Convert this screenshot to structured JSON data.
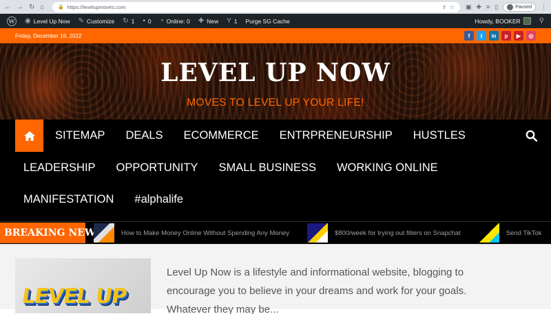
{
  "browser": {
    "url": "https://levelupmoves.com",
    "profile_status": "Paused"
  },
  "adminbar": {
    "site_name": "Level Up Now",
    "customize": "Customize",
    "updates_count": "1",
    "comments_count": "0",
    "online": "Online: 0",
    "new": "New",
    "yoast_count": "1",
    "purge": "Purge SG Cache",
    "howdy": "Howdy, BOOKER"
  },
  "topbar": {
    "date": "Friday, December 16, 2022",
    "social": [
      {
        "icon": "facebook-icon",
        "glyph": "f",
        "color": "#3b5998"
      },
      {
        "icon": "twitter-icon",
        "glyph": "t",
        "color": "#1da1f2"
      },
      {
        "icon": "linkedin-icon",
        "glyph": "in",
        "color": "#0e76a8"
      },
      {
        "icon": "pinterest-icon",
        "glyph": "p",
        "color": "#cb2027"
      },
      {
        "icon": "youtube-icon",
        "glyph": "▶",
        "color": "#cd201f"
      },
      {
        "icon": "instagram-icon",
        "glyph": "◎",
        "color": "#e4405f"
      }
    ]
  },
  "header": {
    "title": "LEVEL UP NOW",
    "tagline": "MOVES TO LEVEL UP YOUR LIFE!"
  },
  "nav": {
    "row1": [
      "SITEMAP",
      "DEALS",
      "ECOMMERCE",
      "ENTRPRENEURSHIP",
      "HUSTLES"
    ],
    "row2": [
      "LEADERSHIP",
      "OPPORTUNITY",
      "SMALL BUSINESS",
      "WORKING ONLINE"
    ],
    "row3": [
      "MANIFESTATION",
      "#alphalife"
    ]
  },
  "breaking": {
    "label": "BREAKING NEWS",
    "items": [
      "How to Make Money Online Without Spending Any Money",
      "$800/week for trying out filters on Snapchat",
      "Send TikTok"
    ]
  },
  "content": {
    "logo_text": "LEVEL UP",
    "description": "Level Up Now is a lifestyle and informational website, blogging to encourage you to believe in your dreams and work for your goals. Whatever they may be..."
  },
  "colors": {
    "accent": "#ff6600",
    "admin_bar": "#1d2327"
  }
}
